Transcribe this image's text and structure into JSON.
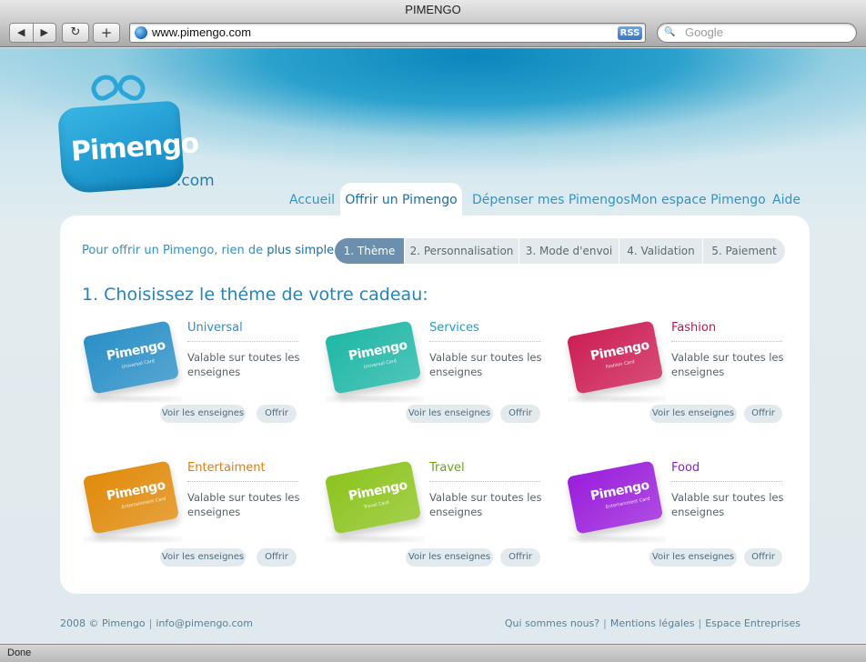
{
  "browser": {
    "title": "PIMENGO",
    "back_glyph": "◀",
    "forward_glyph": "▶",
    "reload_glyph": "↻",
    "add_glyph": "+",
    "url": "www.pimengo.com",
    "rss_label": "RSS",
    "search_placeholder": "Google",
    "search_glyph": "🔍",
    "status": "Done"
  },
  "logo": {
    "word": "Pimengo",
    "suffix": ".com"
  },
  "nav": {
    "tabs": [
      {
        "label": "Accueil"
      },
      {
        "label": "Offrir un Pimengo"
      },
      {
        "label": "Dépenser mes Pimengos"
      },
      {
        "label": "Mon espace Pimengo"
      },
      {
        "label": "Aide"
      }
    ]
  },
  "steps": {
    "intro": "Pour offrir un Pimengo, rien de ",
    "intro_strong": "plus simple:",
    "items": [
      {
        "label": "1. Thème"
      },
      {
        "label": "2. Personnalisation"
      },
      {
        "label": "3. Mode d'envoi"
      },
      {
        "label": "4. Validation"
      },
      {
        "label": "5. Paiement"
      }
    ]
  },
  "heading": "1. Choisissez le théme de votre cadeau:",
  "cards": [
    {
      "title": "Universal",
      "card_name": "Pimengo",
      "card_sub": "Universal Card",
      "desc": "Valable sur toutes les enseignes",
      "btn_view": "Voir les enseignes",
      "btn_offer": "Offrir",
      "color": "#2a8fc6",
      "title_color": "#2a8fc6"
    },
    {
      "title": "Services",
      "card_name": "Pimengo",
      "card_sub": "Universal Card",
      "desc": "Valable sur toutes les enseignes",
      "btn_view": "Voir les enseignes",
      "btn_offer": "Offrir",
      "color": "#20b7a6",
      "title_color": "#1f9ec6"
    },
    {
      "title": "Fashion",
      "card_name": "Pimengo",
      "card_sub": "Fashion Card",
      "desc": "Valable sur toutes les enseignes",
      "btn_view": "Voir les enseignes",
      "btn_offer": "Offrir",
      "color": "#cc1f55",
      "title_color": "#c2184f"
    },
    {
      "title": "Entertaiment",
      "card_name": "Pimengo",
      "card_sub": "Entertainment Card",
      "desc": "Valable sur toutes les enseignes",
      "btn_view": "Voir les enseignes",
      "btn_offer": "Offrir",
      "color": "#e08a0a",
      "title_color": "#e07c0a"
    },
    {
      "title": "Travel",
      "card_name": "Pimengo",
      "card_sub": "Travel Card",
      "desc": "Valable sur toutes les enseignes",
      "btn_view": "Voir les enseignes",
      "btn_offer": "Offrir",
      "color": "#8cc41e",
      "title_color": "#6aa318"
    },
    {
      "title": "Food",
      "card_name": "Pimengo",
      "card_sub": "Entertainment Card",
      "desc": "Valable sur toutes les enseignes",
      "btn_view": "Voir les enseignes",
      "btn_offer": "Offrir",
      "color": "#9a1edb",
      "title_color": "#8a1fd0"
    }
  ],
  "footer": {
    "copyright": "2008 © Pimengo",
    "email": "info@pimengo.com",
    "links": [
      {
        "label": "Qui sommes nous?"
      },
      {
        "label": "Mentions légales"
      },
      {
        "label": "Espace Entreprises"
      }
    ],
    "separator": "|"
  }
}
